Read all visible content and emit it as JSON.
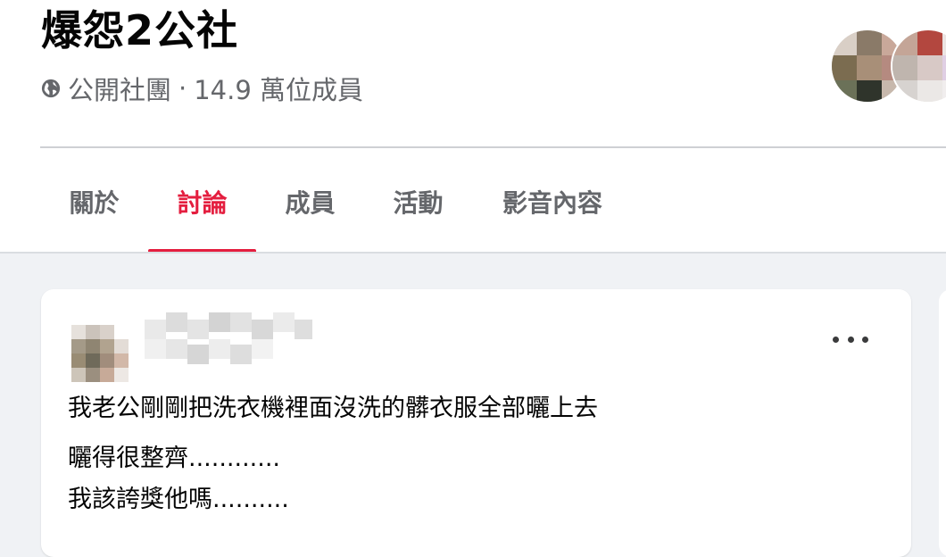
{
  "group": {
    "name": "爆怨2公社",
    "privacy": "公開社團",
    "separator": "·",
    "member_count": "14.9 萬位成員",
    "privacy_icon": "globe-icon"
  },
  "tabs": [
    {
      "label": "關於",
      "active": false
    },
    {
      "label": "討論",
      "active": true
    },
    {
      "label": "成員",
      "active": false
    },
    {
      "label": "活動",
      "active": false
    },
    {
      "label": "影音內容",
      "active": false
    }
  ],
  "colors": {
    "accent": "#e41e3f",
    "text_secondary": "#65676b",
    "background": "#f0f2f5"
  },
  "post": {
    "more_icon": "more-horizontal-icon",
    "lines": [
      "我老公剛剛把洗衣機裡面沒洗的髒衣服全部曬上去",
      "曬得很整齊............",
      "我該誇獎他嗎.........."
    ]
  }
}
